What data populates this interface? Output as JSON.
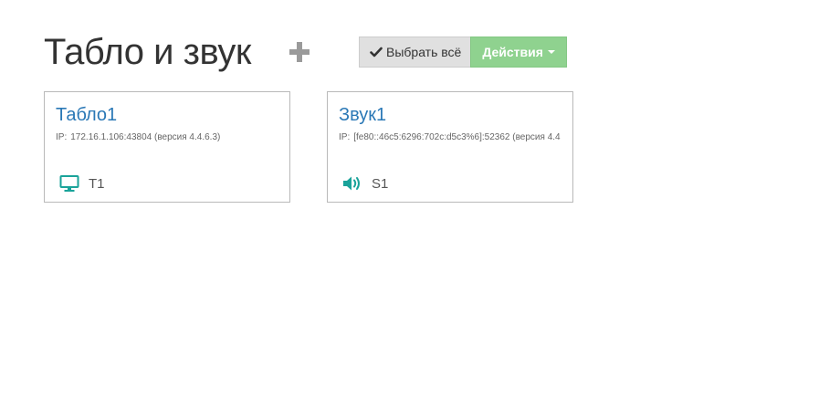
{
  "header": {
    "title": "Табло и звук",
    "add_icon": "plus-icon"
  },
  "toolbar": {
    "select_all_label": "Выбрать всё",
    "select_all_icon": "check-icon",
    "actions_label": "Действия",
    "actions_icon": "caret-down-icon",
    "actions_color": "#8fd28f"
  },
  "devices": [
    {
      "name": "Табло1",
      "ip_label": "IP:",
      "ip_value": "172.16.1.106:43804 (версия 4.4.6.3)",
      "icon": "monitor-icon",
      "item_label": "T1"
    },
    {
      "name": "Звук1",
      "ip_label": "IP:",
      "ip_value": "[fe80::46c5:6296:702c:d5c3%6]:52362 (версия 4.4",
      "icon": "speaker-icon",
      "item_label": "S1"
    }
  ],
  "colors": {
    "link": "#2a78b6",
    "icon_accent": "#1aa39a"
  }
}
